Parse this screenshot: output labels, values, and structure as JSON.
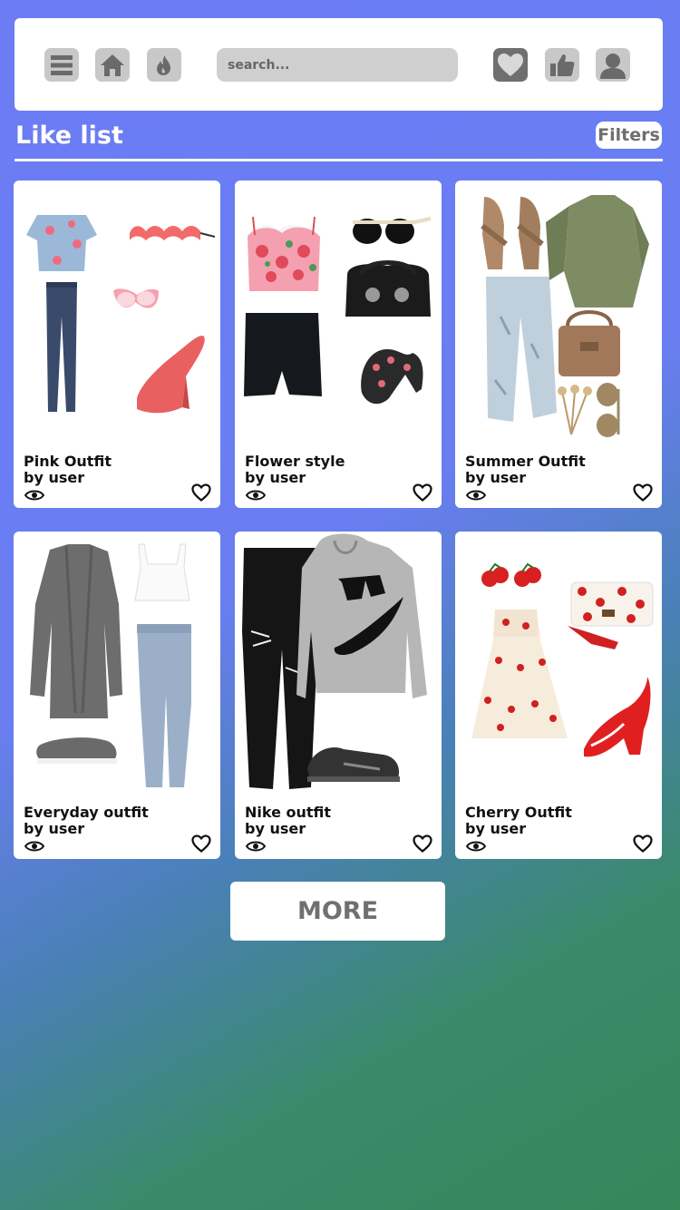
{
  "header": {
    "search_placeholder": "search...",
    "icons": [
      "menu-icon",
      "home-icon",
      "fire-icon",
      "heart-icon",
      "thumbs-up-icon",
      "user-icon"
    ]
  },
  "page": {
    "title": "Like list",
    "filters_label": "Filters"
  },
  "outfits": [
    {
      "name": "Pink Outfit",
      "author": "by user"
    },
    {
      "name": "Flower style",
      "author": "by user"
    },
    {
      "name": "Summer Outfit",
      "author": "by user"
    },
    {
      "name": "Everyday outfit",
      "author": "by user"
    },
    {
      "name": "Nike outfit",
      "author": "by user"
    },
    {
      "name": "Cherry Outfit",
      "author": "by user"
    }
  ],
  "more_label": "MORE",
  "colors": {
    "gradient_top": "#6b7cf5",
    "gradient_bottom": "#35875a",
    "button_gray": "#c8c8c8",
    "button_dark": "#6f6f6f"
  }
}
